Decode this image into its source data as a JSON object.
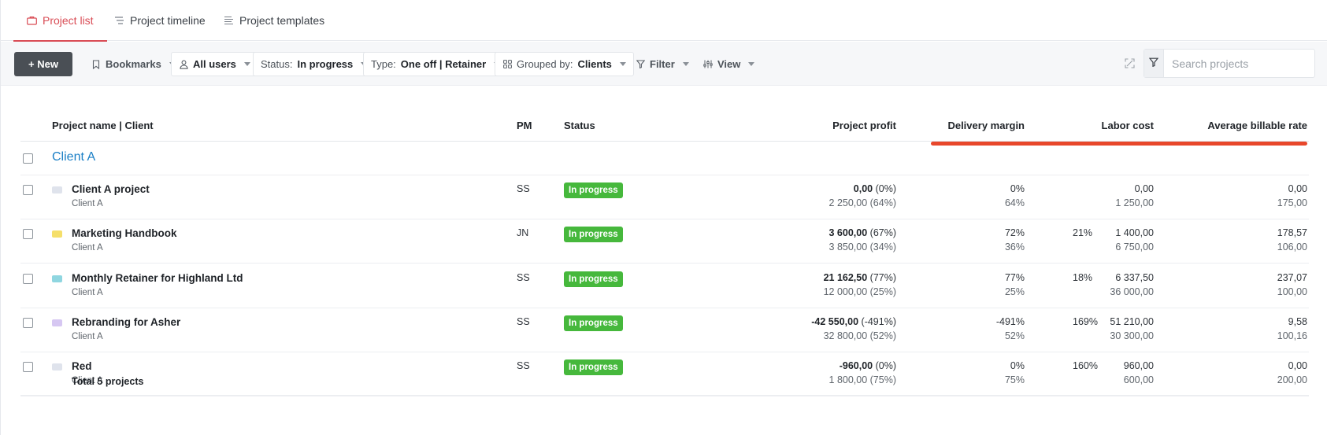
{
  "tabs": [
    {
      "label": "Project list",
      "icon": "briefcase-icon",
      "active": true
    },
    {
      "label": "Project timeline",
      "icon": "timeline-icon",
      "active": false
    },
    {
      "label": "Project templates",
      "icon": "template-icon",
      "active": false
    }
  ],
  "toolbar": {
    "new_label": "+ New",
    "bookmarks_label": "Bookmarks",
    "users_label": "All users",
    "status_prefix": "Status:",
    "status_value": "In progress",
    "type_prefix": "Type:",
    "type_value": "One off | Retainer",
    "group_prefix": "Grouped by:",
    "group_value": "Clients",
    "filter_label": "Filter",
    "view_label": "View",
    "search_placeholder": "Search projects"
  },
  "table": {
    "columns": {
      "name": "Project name | Client",
      "pm": "PM",
      "status": "Status",
      "profit": "Project profit",
      "margin": "Delivery margin",
      "labor": "Labor cost",
      "rate": "Average billable rate"
    },
    "group": {
      "name": "Client A"
    },
    "rows": [
      {
        "name": "Client A project",
        "client": "Client A",
        "pm": "SS",
        "status": "In progress",
        "icon_color": "#dfe3ec",
        "profit_main": "0,00",
        "profit_pct": "(0%)",
        "profit_sub": "2 250,00 (64%)",
        "margin_main": "0%",
        "margin_sub": "64%",
        "labor_main": "0,00",
        "labor_sub": "1 250,00",
        "labor_pct": "",
        "rate_main": "0,00",
        "rate_sub": "175,00"
      },
      {
        "name": "Marketing Handbook",
        "client": "Client A",
        "pm": "JN",
        "status": "In progress",
        "icon_color": "#f5df6a",
        "profit_main": "3 600,00",
        "profit_pct": "(67%)",
        "profit_sub": "3 850,00 (34%)",
        "margin_main": "72%",
        "margin_sub": "36%",
        "labor_main": "1 400,00",
        "labor_sub": "6 750,00",
        "labor_pct": "21%",
        "rate_main": "178,57",
        "rate_sub": "106,00"
      },
      {
        "name": "Monthly Retainer for Highland Ltd",
        "client": "Client A",
        "pm": "SS",
        "status": "In progress",
        "icon_color": "#8fd6e0",
        "profit_main": "21 162,50",
        "profit_pct": "(77%)",
        "profit_sub": "12 000,00 (25%)",
        "margin_main": "77%",
        "margin_sub": "25%",
        "labor_main": "6 337,50",
        "labor_sub": "36 000,00",
        "labor_pct": "18%",
        "rate_main": "237,07",
        "rate_sub": "100,00"
      },
      {
        "name": "Rebranding for Asher",
        "client": "Client A",
        "pm": "SS",
        "status": "In progress",
        "icon_color": "#d6c7f2",
        "profit_main": "-42 550,00",
        "profit_pct": "(-491%)",
        "profit_sub": "32 800,00 (52%)",
        "margin_main": "-491%",
        "margin_sub": "52%",
        "labor_main": "51 210,00",
        "labor_sub": "30 300,00",
        "labor_pct": "169%",
        "rate_main": "9,58",
        "rate_sub": "100,16"
      },
      {
        "name": "Red",
        "client": "Client A",
        "pm": "SS",
        "status": "In progress",
        "icon_color": "#dfe3ec",
        "profit_main": "-960,00",
        "profit_pct": "(0%)",
        "profit_sub": "1 800,00 (75%)",
        "margin_main": "0%",
        "margin_sub": "75%",
        "labor_main": "960,00",
        "labor_sub": "600,00",
        "labor_pct": "160%",
        "rate_main": "0,00",
        "rate_sub": "200,00"
      }
    ],
    "total_label": "Total 5 projects"
  },
  "colors": {
    "accent": "#d94c55",
    "status_green": "#46b83c",
    "group_link": "#1a7fc6",
    "highlight": "#e8472b"
  }
}
